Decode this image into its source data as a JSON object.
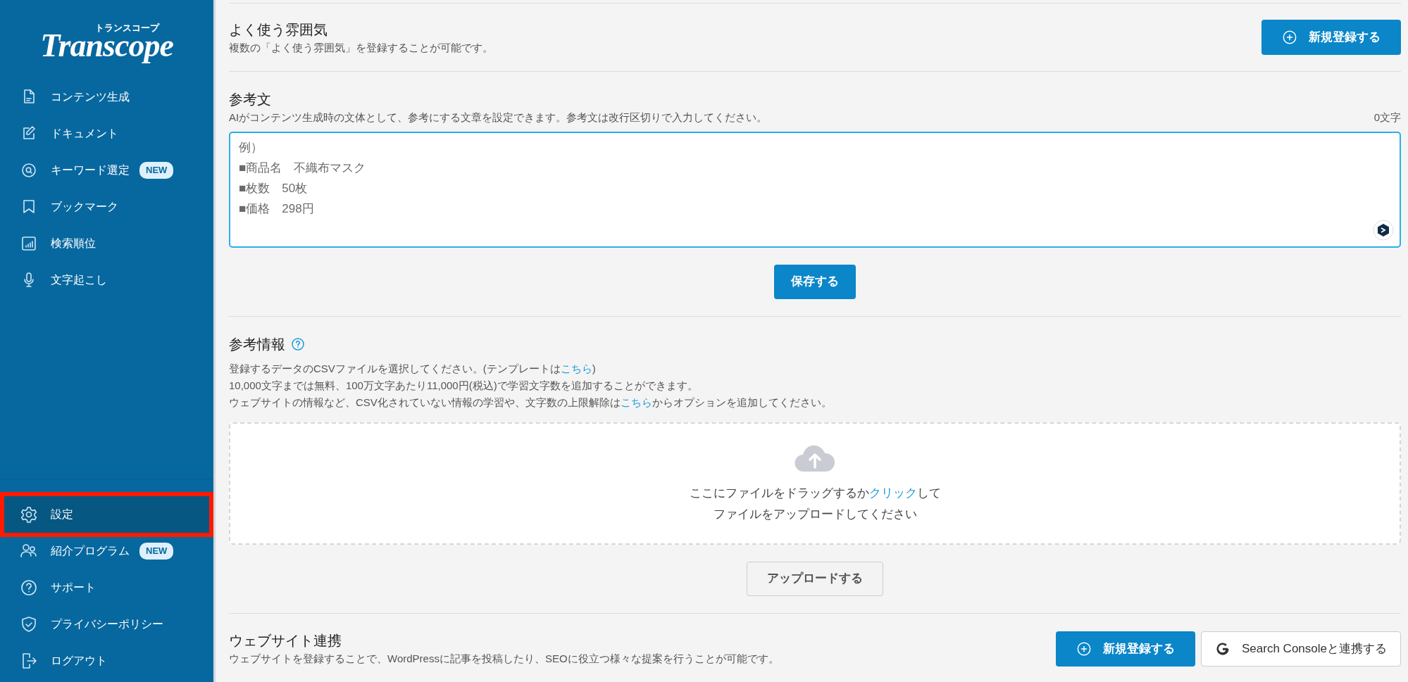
{
  "sidebar": {
    "logo": {
      "text": "Transcope",
      "subtext": "トランスコープ"
    },
    "nav_items": [
      {
        "label": "コンテンツ生成",
        "selected": false,
        "annotated": false
      },
      {
        "label": "ドキュメント",
        "selected": false,
        "annotated": false
      },
      {
        "label": "キーワード選定",
        "badge": "NEW",
        "selected": false,
        "annotated": false
      },
      {
        "label": "ブックマーク",
        "selected": false,
        "annotated": false
      },
      {
        "label": "検索順位",
        "selected": false,
        "annotated": false
      },
      {
        "label": "文字起こし",
        "selected": false,
        "annotated": false
      }
    ],
    "bottom_items": [
      {
        "label": "設定",
        "selected": true,
        "annotated": true
      },
      {
        "label": "紹介プログラム",
        "badge": "NEW",
        "selected": false,
        "annotated": false
      },
      {
        "label": "サポート",
        "selected": false,
        "annotated": false
      },
      {
        "label": "プライバシーポリシー",
        "selected": false,
        "annotated": false
      },
      {
        "label": "ログアウト",
        "selected": false,
        "annotated": false
      }
    ]
  },
  "mood_section": {
    "title": "よく使う雰囲気",
    "description": "複数の「よく使う雰囲気」を登録することが可能です。",
    "button": "新規登録する"
  },
  "reference_text": {
    "title": "参考文",
    "description": "AIがコンテンツ生成時の文体として、参考にする文章を設定できます。参考文は改行区切りで入力してください。",
    "counter": "0文字",
    "placeholder": "例）\n■商品名　不織布マスク\n■枚数　50枚\n■価格　298円",
    "save_button": "保存する"
  },
  "reference_info": {
    "title": "参考情報",
    "lines": [
      {
        "text": "登録するデータのCSVファイルを選択してください。(テンプレートは",
        "link": "こちら",
        "after": ")"
      },
      {
        "text": "10,000文字までは無料、100万文字あたり11,000円(税込)で学習文字数を追加することができます。"
      },
      {
        "text": "ウェブサイトの情報など、CSV化されていない情報の学習や、文字数の上限解除は",
        "link": "こちら",
        "after": "からオプションを追加してください。"
      }
    ],
    "dropzone": {
      "line1": {
        "text": "ここにファイルをドラッグするか",
        "link": "クリック",
        "after": "して"
      },
      "line2": "ファイルをアップロードしてください"
    },
    "upload_button": "アップロードする"
  },
  "website": {
    "title": "ウェブサイト連携",
    "description": "ウェブサイトを登録することで、WordPressに記事を投稿したり、SEOに役立つ様々な提案を行うことが可能です。",
    "buttons": [
      {
        "label": "新規登録する",
        "kind": "primary"
      },
      {
        "label": "Search Consoleと連携する",
        "kind": "google"
      }
    ]
  }
}
